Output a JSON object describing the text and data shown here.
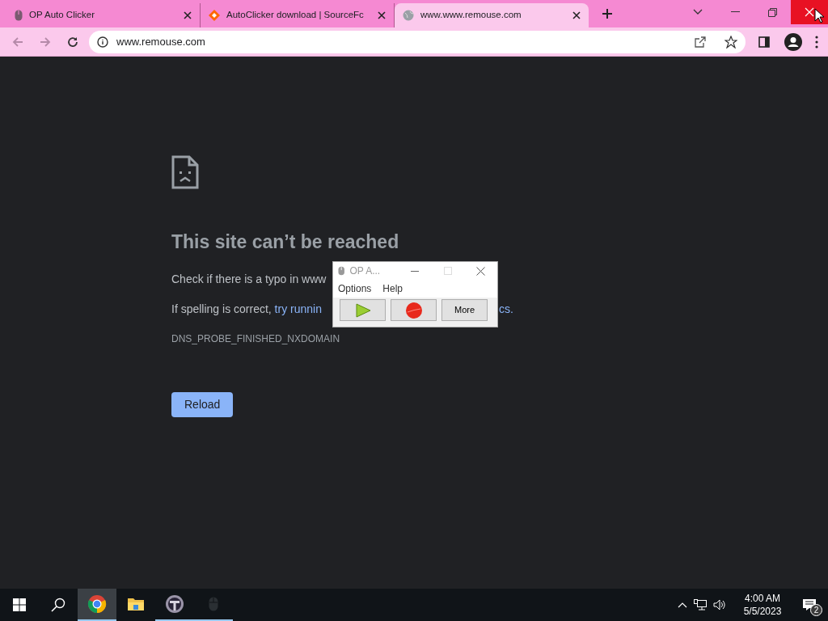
{
  "tabs": [
    {
      "title": "OP Auto Clicker",
      "kind": "mouse",
      "selected": false
    },
    {
      "title": "AutoClicker download | SourceFc",
      "kind": "diamond",
      "selected": false
    },
    {
      "title": "www.www.remouse.com",
      "kind": "globe",
      "selected": true
    }
  ],
  "address_bar": {
    "url": "www.remouse.com"
  },
  "error_page": {
    "heading": "This site can’t be reached",
    "line_1": "Check if there is a typo in www",
    "line_2_start": "If spelling is correct,",
    "line_2_link": "try runnin",
    "line_2_end": "cs.",
    "error_code": "DNS_PROBE_FINISHED_NXDOMAIN",
    "button": "Reload"
  },
  "popup_window": {
    "title": "OP A...",
    "menu": [
      "Options",
      "Help"
    ],
    "buttons": [
      {
        "kind": "start"
      },
      {
        "kind": "stop"
      },
      {
        "kind": "text",
        "label": "More"
      }
    ]
  },
  "taskbar": {
    "apps": [
      {
        "kind": "chrome",
        "active": true,
        "running": true
      },
      {
        "kind": "folder",
        "active": false,
        "running": false
      },
      {
        "kind": "t-app",
        "active": false,
        "running": true
      },
      {
        "kind": "mouse",
        "active": false,
        "running": true
      }
    ],
    "time": "4:00 AM",
    "date": "5/5/2023",
    "notifications": "2"
  }
}
